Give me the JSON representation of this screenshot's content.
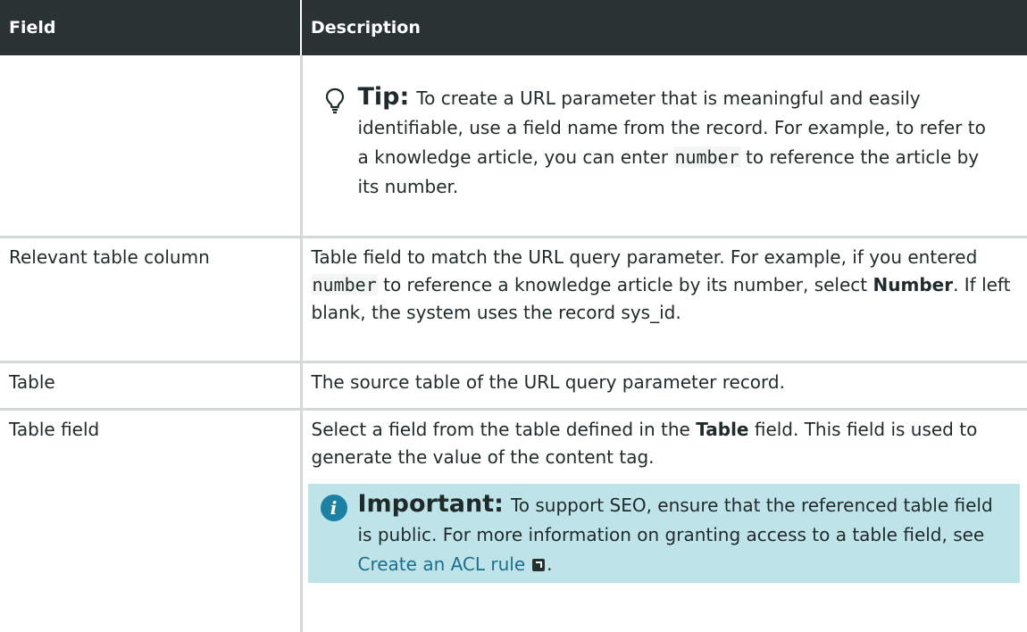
{
  "header": {
    "field": "Field",
    "description": "Description"
  },
  "tip": {
    "label": "Tip:",
    "text_before": "To create a URL parameter that is meaningful and easily identifiable, use a field name from the record. For example, to refer to a knowledge article, you can enter",
    "code": "number",
    "text_after": "to reference the article by its number."
  },
  "rows": {
    "relevant_column": {
      "field": "Relevant table column",
      "text_before": "Table field to match the URL query parameter. For example, if you entered",
      "code": "number",
      "text_middle": "to reference a knowledge article by its number, select",
      "bold": "Number",
      "text_after": ". If left blank, the system uses the record sys_id."
    },
    "table": {
      "field": "Table",
      "description": "The source table of the URL query parameter record."
    },
    "table_field": {
      "field": "Table field",
      "text_before": "Select a field from the table defined in the",
      "bold": "Table",
      "text_after": "field. This field is used to generate the value of the content tag."
    }
  },
  "important": {
    "icon_glyph": "i",
    "label": "Important:",
    "text": "To support SEO, ensure that the referenced table field is public. For more information on granting access to a table field, see",
    "link": "Create an ACL rule",
    "trailing": "."
  },
  "colors": {
    "header_bg": "#2b3233",
    "note_bg": "#bee3e8",
    "link": "#1b6f8c",
    "info_icon": "#1b80a2",
    "border": "#d4d8d8"
  }
}
